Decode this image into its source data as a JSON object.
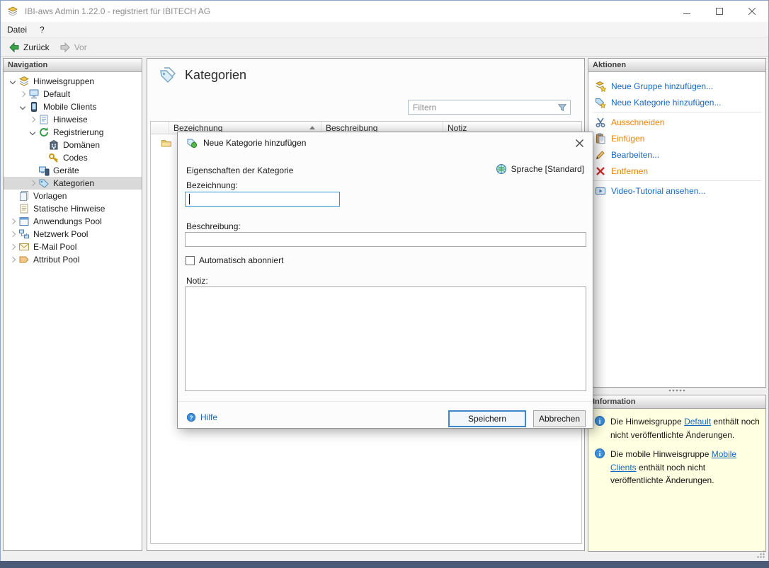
{
  "window": {
    "title": "IBI-aws Admin 1.22.0 - registriert für IBITECH AG"
  },
  "menu": {
    "items": [
      {
        "label": "Datei"
      },
      {
        "label": "?"
      }
    ]
  },
  "toolbar": {
    "back_label": "Zurück",
    "forward_label": "Vor"
  },
  "navigation": {
    "header": "Navigation",
    "tree": [
      {
        "label": "Hinweisgruppen",
        "level": 0,
        "chevron": "expanded",
        "icon": "hint-groups-icon"
      },
      {
        "label": "Default",
        "level": 1,
        "chevron": "collapsed",
        "icon": "computer-icon"
      },
      {
        "label": "Mobile Clients",
        "level": 1,
        "chevron": "expanded",
        "icon": "mobile-client-icon"
      },
      {
        "label": "Hinweise",
        "level": 2,
        "chevron": "collapsed",
        "icon": "notes-icon"
      },
      {
        "label": "Registrierung",
        "level": 2,
        "chevron": "expanded",
        "icon": "registration-icon"
      },
      {
        "label": "Domänen",
        "level": 3,
        "chevron": "none",
        "icon": "domain-icon"
      },
      {
        "label": "Codes",
        "level": 3,
        "chevron": "none",
        "icon": "key-icon"
      },
      {
        "label": "Geräte",
        "level": 2,
        "chevron": "none",
        "icon": "devices-icon"
      },
      {
        "label": "Kategorien",
        "level": 2,
        "chevron": "collapsed",
        "icon": "tag-icon",
        "selected": true
      },
      {
        "label": "Vorlagen",
        "level": 0,
        "chevron": "none",
        "icon": "templates-icon"
      },
      {
        "label": "Statische Hinweise",
        "level": 0,
        "chevron": "none",
        "icon": "static-notes-icon"
      },
      {
        "label": "Anwendungs Pool",
        "level": 0,
        "chevron": "collapsed",
        "icon": "application-pool-icon"
      },
      {
        "label": "Netzwerk Pool",
        "level": 0,
        "chevron": "collapsed",
        "icon": "network-pool-icon"
      },
      {
        "label": "E-Mail Pool",
        "level": 0,
        "chevron": "collapsed",
        "icon": "email-pool-icon"
      },
      {
        "label": "Attribut Pool",
        "level": 0,
        "chevron": "collapsed",
        "icon": "attribute-pool-icon"
      }
    ]
  },
  "main": {
    "title": "Kategorien",
    "filter": {
      "placeholder": "Filtern"
    },
    "table": {
      "columns": [
        "Bezeichnung",
        "Beschreibung",
        "Notiz"
      ],
      "sort": {
        "column": "Bezeichnung",
        "direction": "ascending"
      },
      "rows": [
        {
          "icon": "folder-icon"
        }
      ]
    }
  },
  "dialog": {
    "title": "Neue Kategorie hinzufügen",
    "properties_heading": "Eigenschaften der Kategorie",
    "language_button": "Sprache [Standard]",
    "bezeichnung": {
      "label": "Bezeichnung:",
      "value": ""
    },
    "beschreibung": {
      "label": "Beschreibung:",
      "value": ""
    },
    "auto_subscribe": {
      "label": "Automatisch abonniert",
      "checked": false
    },
    "notiz": {
      "label": "Notiz:",
      "value": ""
    },
    "help_label": "Hilfe",
    "save_label": "Speichern",
    "cancel_label": "Abbrechen"
  },
  "actions": {
    "header": "Aktionen",
    "items": [
      {
        "label": "Neue Gruppe hinzufügen...",
        "style": "blue",
        "icon": "add-group-icon"
      },
      {
        "label": "Neue Kategorie hinzufügen...",
        "style": "blue",
        "icon": "add-category-icon"
      },
      {
        "label": "Ausschneiden",
        "style": "orange",
        "icon": "cut-icon"
      },
      {
        "label": "Einfügen",
        "style": "orange",
        "icon": "paste-icon"
      },
      {
        "label": "Bearbeiten...",
        "style": "blue",
        "icon": "edit-icon"
      },
      {
        "label": "Entfernen",
        "style": "orange",
        "icon": "delete-icon"
      },
      {
        "label": "Video-Tutorial ansehen...",
        "style": "blue",
        "icon": "video-icon"
      }
    ]
  },
  "information": {
    "header": "Information",
    "items": [
      {
        "prefix": "Die Hinweisgruppe ",
        "link": "Default",
        "suffix": " enthält noch nicht veröffentlichte Änderungen."
      },
      {
        "prefix": "Die mobile Hinweisgruppe ",
        "link": "Mobile Clients",
        "suffix": " enthält noch nicht veröffentlichte Änderungen."
      }
    ]
  },
  "colors": {
    "action_blue": "#1767c0",
    "action_orange": "#e8830c",
    "info_background": "#ffffe1",
    "focused_input_border": "#2f96d2",
    "selected_tree_background": "#d9d9d9"
  }
}
